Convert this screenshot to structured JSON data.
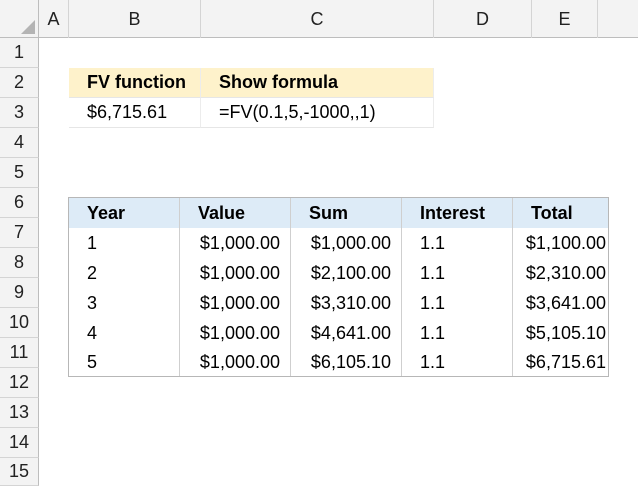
{
  "columns": [
    {
      "letter": "A"
    },
    {
      "letter": "B"
    },
    {
      "letter": "C"
    },
    {
      "letter": "D"
    },
    {
      "letter": "E"
    }
  ],
  "rows": [
    "1",
    "2",
    "3",
    "4",
    "5",
    "6",
    "7",
    "8",
    "9",
    "10",
    "11",
    "12",
    "13",
    "14",
    "15"
  ],
  "fv_table": {
    "header_b": "FV function",
    "header_c": "Show formula",
    "value": "$6,715.61",
    "formula": "=FV(0.1,5,-1000,,1)"
  },
  "data_table": {
    "headers": [
      "Year",
      "Value",
      "Sum",
      "Interest",
      "Total"
    ],
    "rows": [
      [
        "1",
        "$1,000.00",
        "$1,000.00",
        "1.1",
        "$1,100.00"
      ],
      [
        "2",
        "$1,000.00",
        "$2,100.00",
        "1.1",
        "$2,310.00"
      ],
      [
        "3",
        "$1,000.00",
        "$3,310.00",
        "1.1",
        "$3,641.00"
      ],
      [
        "4",
        "$1,000.00",
        "$4,641.00",
        "1.1",
        "$5,105.10"
      ],
      [
        "5",
        "$1,000.00",
        "$6,105.10",
        "1.1",
        "$6,715.61"
      ]
    ]
  },
  "colors": {
    "fv_header_fill": "#fef2cb",
    "table_header_fill": "#ddebf7",
    "header_gray": "#f3f3f3"
  }
}
